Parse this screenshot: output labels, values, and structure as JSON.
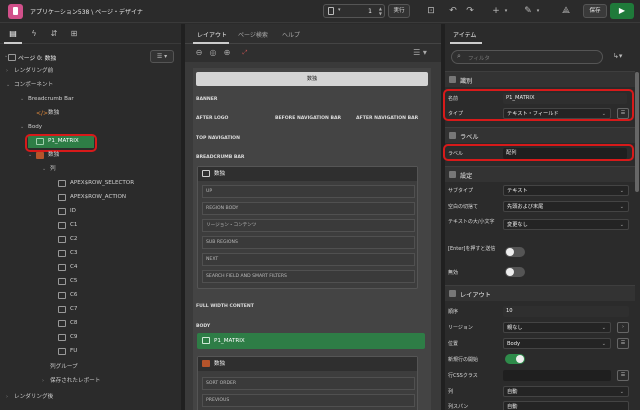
{
  "app": {
    "title": "アプリケーション538 \\ ページ・デザイナ",
    "page_number": "1",
    "run_label": "実行",
    "save_label": "保存"
  },
  "left_panel": {
    "page_label": "ページ 0: 数独",
    "tree": [
      {
        "label": "レンダリング前",
        "name": "tree-before-render"
      },
      {
        "label": "コンポーネント",
        "name": "tree-components"
      },
      {
        "label": "Breadcrumb Bar",
        "name": "tree-breadcrumb-bar"
      },
      {
        "label": "数独",
        "name": "tree-breadcrumb-sudoku"
      },
      {
        "label": "Body",
        "name": "tree-body"
      },
      {
        "label": "P1_MATRIX",
        "name": "tree-p1-matrix"
      },
      {
        "label": "数独",
        "name": "tree-region-sudoku"
      },
      {
        "label": "列",
        "name": "tree-columns"
      },
      {
        "label": "APEX$ROW_SELECTOR",
        "name": "tree-col-row-selector"
      },
      {
        "label": "APEX$ROW_ACTION",
        "name": "tree-col-row-action"
      },
      {
        "label": "ID",
        "name": "tree-col-id"
      },
      {
        "label": "C1",
        "name": "tree-col-c1"
      },
      {
        "label": "C2",
        "name": "tree-col-c2"
      },
      {
        "label": "C3",
        "name": "tree-col-c3"
      },
      {
        "label": "C4",
        "name": "tree-col-c4"
      },
      {
        "label": "C5",
        "name": "tree-col-c5"
      },
      {
        "label": "C6",
        "name": "tree-col-c6"
      },
      {
        "label": "C7",
        "name": "tree-col-c7"
      },
      {
        "label": "C8",
        "name": "tree-col-c8"
      },
      {
        "label": "C9",
        "name": "tree-col-c9"
      },
      {
        "label": "FU",
        "name": "tree-col-fu"
      },
      {
        "label": "列グループ",
        "name": "tree-column-groups"
      },
      {
        "label": "保存されたレポート",
        "name": "tree-saved-reports"
      },
      {
        "label": "レンダリング後",
        "name": "tree-after-render"
      }
    ]
  },
  "center": {
    "tabs": [
      "レイアウト",
      "ページ検索",
      "ヘルプ"
    ],
    "top_region": "数独",
    "banner": "BANNER",
    "after_logo": "AFTER LOGO",
    "before_nav": "BEFORE NAVIGATION BAR",
    "after_nav": "AFTER NAVIGATION BAR",
    "top_navigation": "TOP NAVIGATION",
    "breadcrumb_bar": "BREADCRUMB BAR",
    "breadcrumb_region": "数独",
    "slots": [
      "UP",
      "REGION BODY",
      "リージョン・コンテンツ",
      "SUB REGIONS",
      "NEXT",
      "SEARCH FIELD AND SMART FILTERS"
    ],
    "full_width": "FULL WIDTH CONTENT",
    "body": "BODY",
    "matrix_item": "P1_MATRIX",
    "body_region": "数独",
    "body_slots": [
      "SORT ORDER",
      "PREVIOUS"
    ]
  },
  "right_panel": {
    "tab": "アイテム",
    "filter_placeholder": "フィルタ",
    "groups": {
      "identification": "識別",
      "label": "ラベル",
      "settings": "設定",
      "layout": "レイアウト"
    },
    "props": {
      "name_label": "名前",
      "name_value": "P1_MATRIX",
      "type_label": "タイプ",
      "type_value": "テキスト・フィールド",
      "label_label": "ラベル",
      "label_value": "配列",
      "subtype_label": "サブタイプ",
      "subtype_value": "テキスト",
      "trim_label": "空白の切捨て",
      "trim_value": "先頭および末尾",
      "case_label": "テキストの大/小文字",
      "case_value": "変更なし",
      "enter_label": "[Enter]を押すと送信",
      "disabled_label": "無効",
      "seq_label": "順序",
      "seq_value": "10",
      "region_label": "リージョン",
      "region_value": "親なし",
      "position_label": "位置",
      "position_value": "Body",
      "newline_label": "新規行の開始",
      "rowcss_label": "行CSSクラス",
      "column_label": "列",
      "column_value": "自動",
      "colspan_label": "列スパン",
      "colspan_value": "自動"
    },
    "toggles": {
      "enter_submit": false,
      "disabled": false,
      "new_row": true
    }
  },
  "colors": {
    "highlight": "#d71a1a",
    "accent_green": "#2e7d46",
    "app_pink": "#d1508a"
  }
}
